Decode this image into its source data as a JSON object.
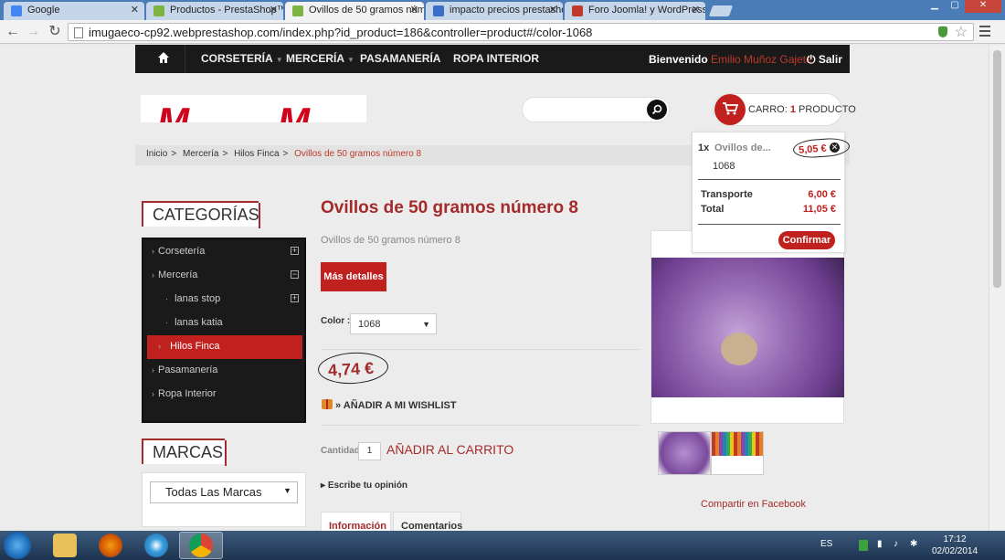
{
  "browser": {
    "tabs": [
      {
        "label": "Google",
        "favicon_color": "#4285f4",
        "active": false
      },
      {
        "label": "Productos - PrestaShop™",
        "favicon_color": "#7cb342",
        "active": false
      },
      {
        "label": "Ovillos de 50 gramos núm",
        "favicon_color": "#7cb342",
        "active": true
      },
      {
        "label": "impacto precios prestasho",
        "favicon_color": "#3b6fc7",
        "active": false
      },
      {
        "label": "Foro Joomla! y WordPress",
        "favicon_color": "#c0392b",
        "active": false
      }
    ],
    "url": "imugaeco-cp92.webprestashop.com/index.php?id_product=186&controller=product#/color-1068"
  },
  "site_nav": {
    "items": [
      "CORSETERÍA",
      "MERCERÍA",
      "PASAMANERÍA",
      "ROPA INTERIOR"
    ],
    "welcome": "Bienvenido",
    "user_name": "Emilio Muñoz Gajete",
    "logout": "Salir"
  },
  "cart": {
    "label": "CARRO:",
    "count": "1",
    "unit": "PRODUCTO",
    "dropdown": {
      "qty": "1x",
      "product_name": "Ovillos de...",
      "product_price": "5,05 €",
      "attribute": "1068",
      "shipping_label": "Transporte",
      "shipping_value": "6,00 €",
      "total_label": "Total",
      "total_value": "11,05 €",
      "confirm_label": "Confirmar"
    }
  },
  "breadcrumb": {
    "items": [
      "Inicio",
      "Mercería",
      "Hilos Finca"
    ],
    "current": "Ovillos de 50 gramos número 8"
  },
  "sidebar": {
    "categories_title": "CATEGORÍAS",
    "categories": [
      {
        "label": "Corsetería",
        "toggle": "+"
      },
      {
        "label": "Mercería",
        "toggle": "−"
      },
      {
        "label": "lanas stop",
        "toggle": "+"
      },
      {
        "label": "lanas katia",
        "toggle": ""
      },
      {
        "label": "Hilos Finca",
        "toggle": "",
        "active": true
      },
      {
        "label": "Pasamanería",
        "toggle": ""
      },
      {
        "label": "Ropa Interior",
        "toggle": ""
      }
    ],
    "brands_title": "MARCAS",
    "brands_select": "Todas Las Marcas"
  },
  "product": {
    "title": "Ovillos de 50 gramos número 8",
    "subtitle": "Ovillos de 50 gramos número 8",
    "more_details": "Más detalles",
    "color_label": "Color :",
    "color_value": "1068",
    "price": "4,74 €",
    "wishlist": "» AÑADIR A MI WISHLIST",
    "quantity_label": "Cantidad",
    "quantity_value": "1",
    "add_to_cart": "AÑADIR AL CARRITO",
    "review": "Escribe tu opinión",
    "tabs": [
      "Información",
      "Comentarios"
    ],
    "share": "Compartir en Facebook"
  },
  "taskbar": {
    "language": "ES",
    "time": "17:12",
    "date": "02/02/2014"
  },
  "colors": {
    "accent": "#c0201e",
    "title": "#a52a2a",
    "nav_bg": "#1a1a1a"
  }
}
